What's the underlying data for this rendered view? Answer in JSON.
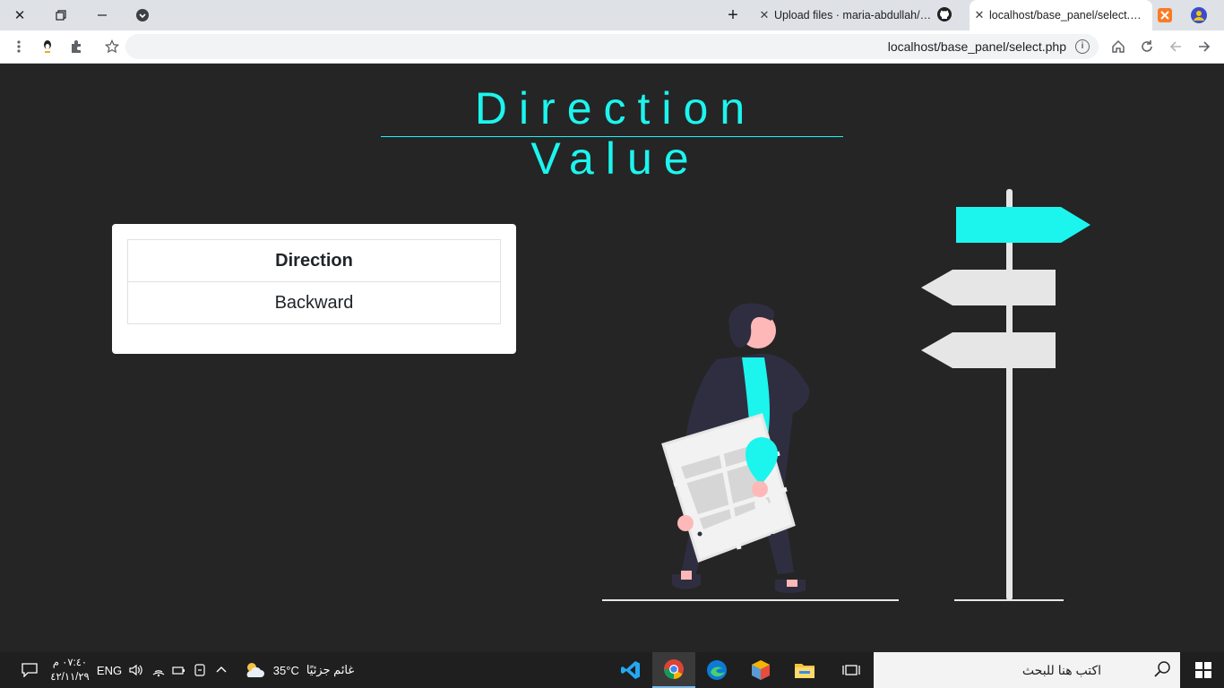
{
  "tabs": [
    {
      "title": "Upload files · maria-abdullah/Bas",
      "active": false
    },
    {
      "title": "localhost/base_panel/select.php",
      "active": true
    }
  ],
  "address": {
    "url": "localhost/base_panel/select.php"
  },
  "page": {
    "heading": "Direction Value",
    "table": {
      "header": "Direction",
      "value": "Backward"
    }
  },
  "taskbar": {
    "search_placeholder": "اكتب هنا للبحث",
    "weather_temp": "35°C",
    "weather_desc": "غائم جزئيًا",
    "language": "ENG",
    "time": "٠٧:٤٠ م",
    "date": "٤٢/١١/٢٩"
  },
  "colors": {
    "accent": "#1cf5ee",
    "page_bg": "#252525",
    "figure_dark": "#2f2e41",
    "skin": "#ffb8b8",
    "sign_gray": "#e6e6e6"
  },
  "icons": [
    "close-icon",
    "restore-icon",
    "minimize-icon",
    "tab-search-icon",
    "new-tab-icon",
    "github-icon",
    "menu-icon",
    "extension-icon",
    "star-icon",
    "info-icon",
    "home-icon",
    "reload-icon",
    "back-icon",
    "forward-icon",
    "search-icon",
    "windows-icon"
  ]
}
